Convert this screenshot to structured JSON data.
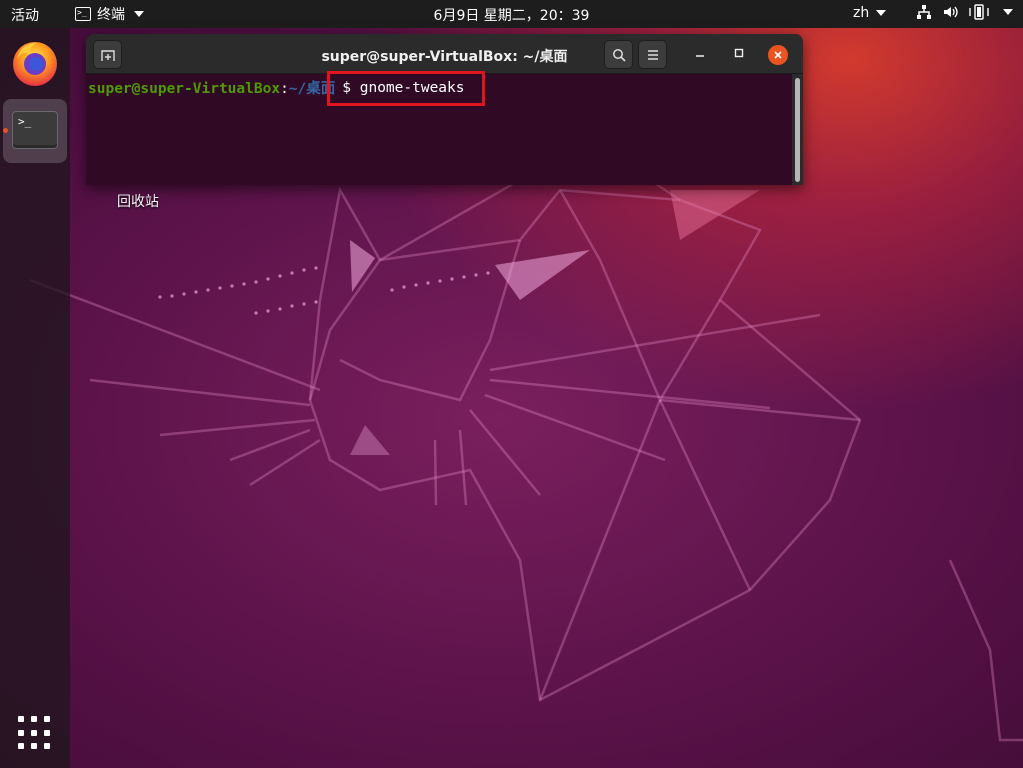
{
  "topbar": {
    "activities": "活动",
    "app_menu_label": "终端",
    "clock": "6月9日 星期二，20：39",
    "lang": "zh",
    "icons": [
      "network-icon",
      "volume-icon",
      "battery-icon",
      "system-menu-caret"
    ]
  },
  "dock": {
    "items": [
      "firefox",
      "terminal"
    ],
    "apps_button": "show-applications"
  },
  "desktop": {
    "trash_label": "回收站"
  },
  "terminal": {
    "title": "super@super-VirtualBox: ~/桌面",
    "prompt_user": "super@super-VirtualBox",
    "prompt_sep": ":",
    "prompt_path": "~/桌面",
    "prompt_dollar": "$",
    "command": "gnome-tweaks",
    "highlight_color": "#e0141e"
  },
  "colors": {
    "accent": "#e95420",
    "terminal_bg": "#300a24",
    "prompt_user": "#4e9a06",
    "prompt_path": "#3465a4"
  }
}
